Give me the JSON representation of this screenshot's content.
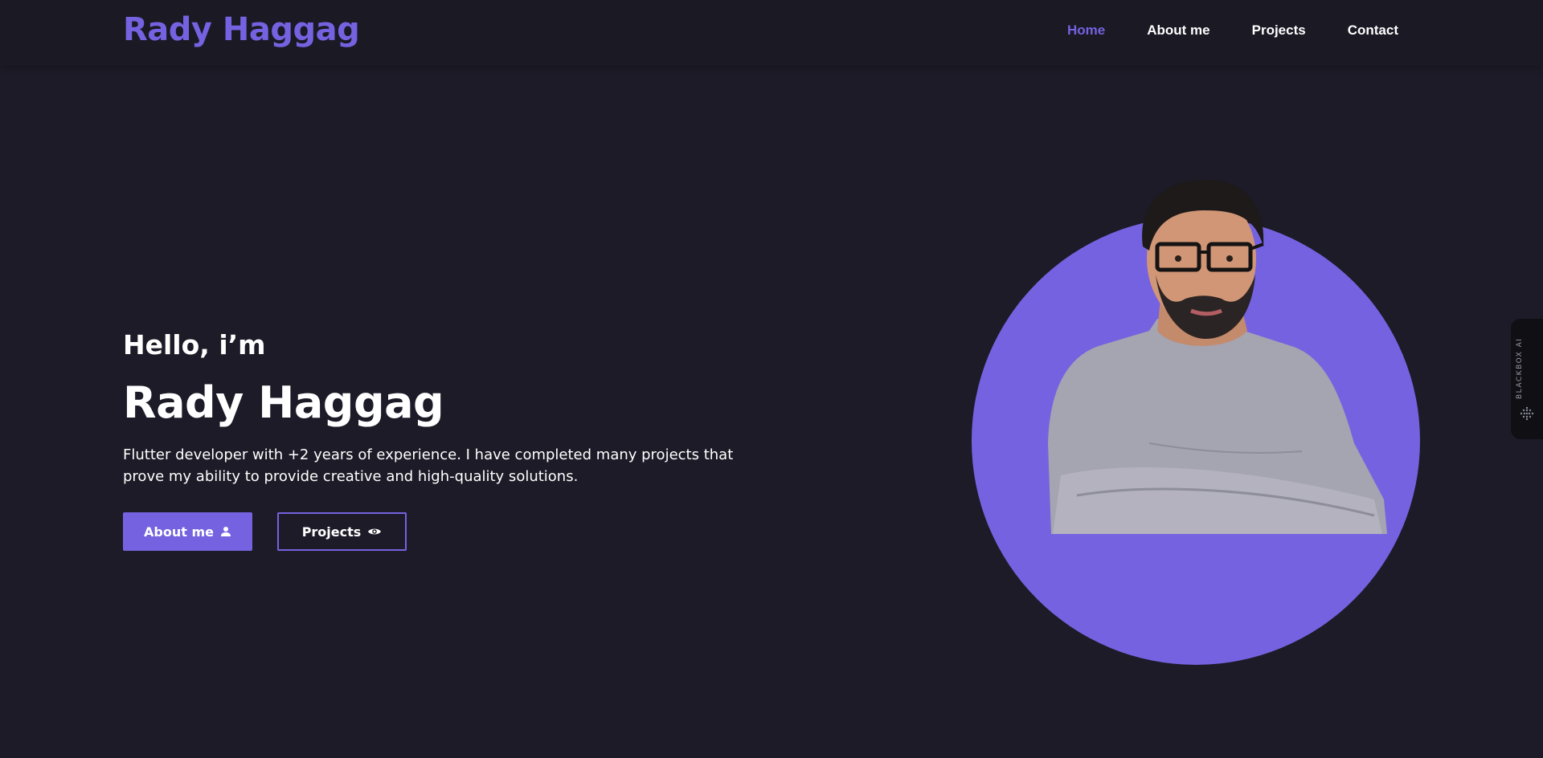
{
  "header": {
    "logo": "Rady Haggag",
    "nav": [
      {
        "label": "Home",
        "active": true
      },
      {
        "label": "About me",
        "active": false
      },
      {
        "label": "Projects",
        "active": false
      },
      {
        "label": "Contact",
        "active": false
      }
    ]
  },
  "hero": {
    "greeting": "Hello, i’m",
    "name": "Rady Haggag",
    "description": "Flutter developer with +2 years of experience. I have completed many projects that prove my ability to provide creative and high-quality solutions.",
    "buttons": {
      "about_label": "About me",
      "about_icon": "person-icon",
      "projects_label": "Projects",
      "projects_icon": "eye-icon"
    }
  },
  "side_widget": {
    "label": "BLACKBOX AI"
  },
  "colors": {
    "accent": "#7562e0",
    "background": "#1c1b27",
    "header_background": "#1a1924",
    "text": "#ffffff"
  }
}
